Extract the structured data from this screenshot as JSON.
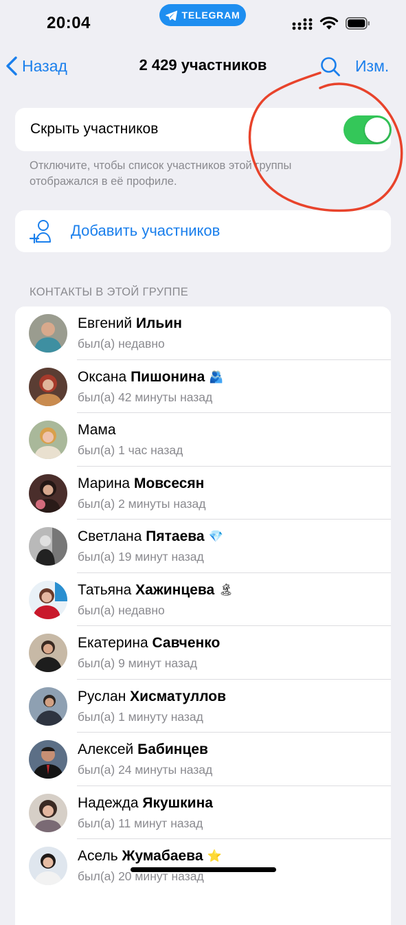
{
  "status_bar": {
    "time": "20:04",
    "pill_label": "TELEGRAM"
  },
  "nav": {
    "back_label": "Назад",
    "title": "2 429 участников",
    "edit_label": "Изм."
  },
  "hide_members": {
    "label": "Скрыть участников",
    "enabled": true,
    "footnote": "Отключите, чтобы список участников этой группы отображался в её профиле."
  },
  "add_members_label": "Добавить участников",
  "section_header": "КОНТАКТЫ В ЭТОЙ ГРУППЕ",
  "colors": {
    "accent": "#1a7fec",
    "toggle_on": "#34c759",
    "annotation": "#e8432b",
    "pill": "#1e8ef0"
  },
  "members": [
    {
      "first": "Евгений",
      "last": "Ильин",
      "emoji": "",
      "status": "был(а) недавно"
    },
    {
      "first": "Оксана",
      "last": "Пишонина",
      "emoji": "🫂",
      "status": "был(а) 42 минуты назад"
    },
    {
      "first": "Мама",
      "last": "",
      "emoji": "",
      "status": "был(а) 1 час назад"
    },
    {
      "first": "Марина",
      "last": "Мовсесян",
      "emoji": "",
      "status": "был(а) 2 минуты назад"
    },
    {
      "first": "Светлана",
      "last": "Пятаева",
      "emoji": "💎",
      "status": "был(а) 19 минут назад"
    },
    {
      "first": "Татьяна",
      "last": "Хажинцева",
      "emoji": "🏝",
      "status": "был(а) недавно"
    },
    {
      "first": "Екатерина",
      "last": "Савченко",
      "emoji": "",
      "status": "был(а) 9 минут назад"
    },
    {
      "first": "Руслан",
      "last": "Хисматуллов",
      "emoji": "",
      "status": "был(а) 1 минуту назад"
    },
    {
      "first": "Алексей",
      "last": "Бабинцев",
      "emoji": "",
      "status": "был(а) 24 минуты назад"
    },
    {
      "first": "Надежда",
      "last": "Якушкина",
      "emoji": "",
      "status": "был(а) 11 минут назад"
    },
    {
      "first": "Асель",
      "last": "Жумабаева",
      "emoji": "⭐",
      "status": "был(а) 20 минут назад"
    }
  ]
}
